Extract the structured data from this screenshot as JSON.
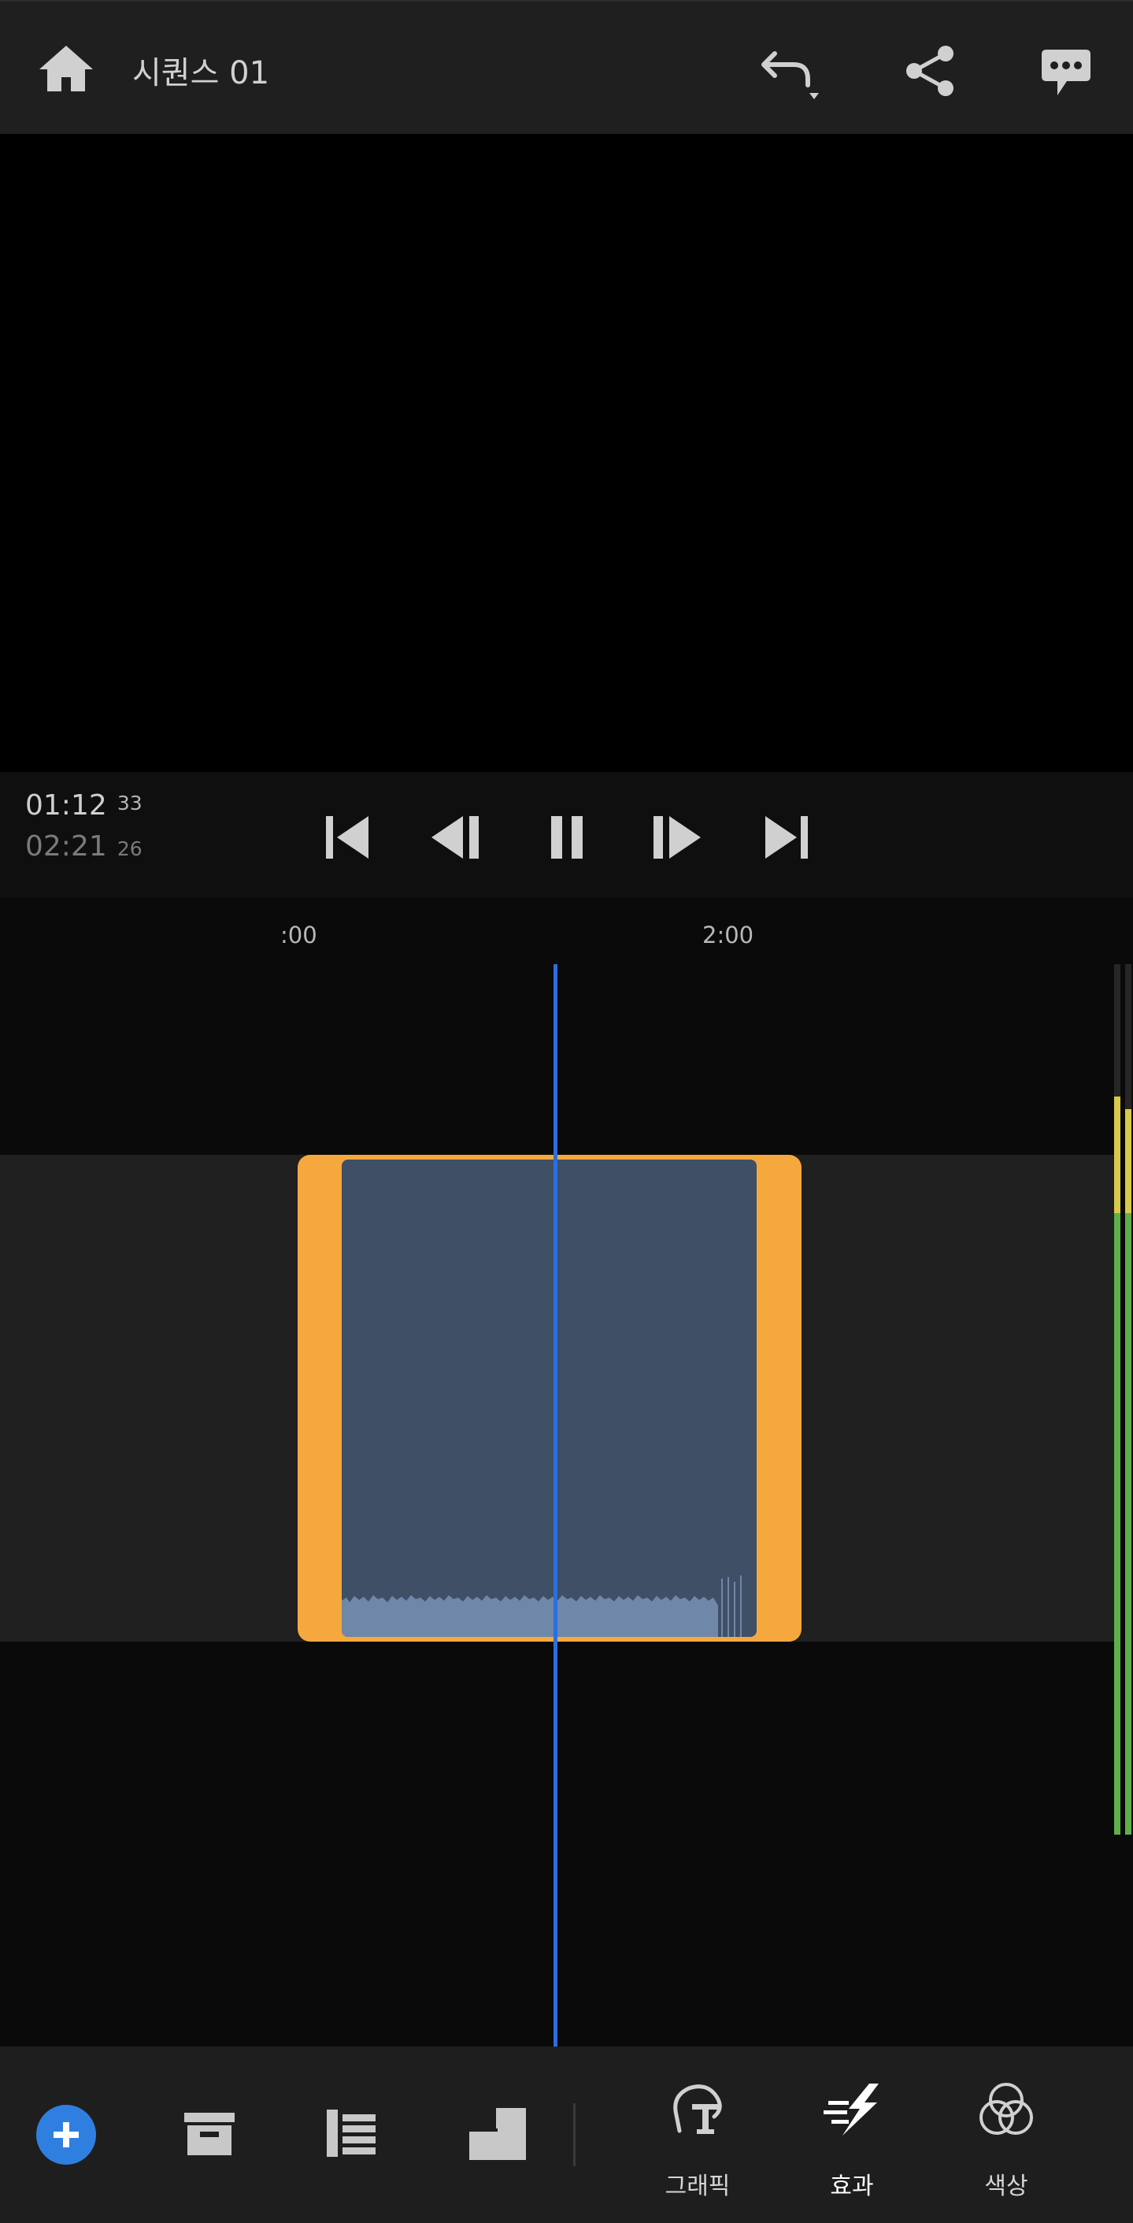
{
  "header": {
    "title": "시퀀스 01",
    "icons": [
      "home-icon",
      "undo-icon",
      "share-icon",
      "comment-icon"
    ]
  },
  "transport": {
    "current_time": "01:12",
    "current_frame": "33",
    "total_time": "02:21",
    "total_frame": "26",
    "controls": [
      "skip-to-start-icon",
      "step-back-icon",
      "pause-icon",
      "step-forward-icon",
      "skip-to-end-icon"
    ]
  },
  "timeline": {
    "ruler_labels": [
      ":00",
      "2:00"
    ]
  },
  "bottom_toolbar": {
    "left_tools": [
      "add-icon",
      "archive-icon",
      "list-icon",
      "layers-icon"
    ],
    "tabs": [
      {
        "label": "그래픽",
        "icon": "graphics-icon"
      },
      {
        "label": "효과",
        "icon": "effects-icon"
      },
      {
        "label": "색상",
        "icon": "color-icon"
      }
    ]
  },
  "colors": {
    "clip_border": "#f5a83d",
    "clip_fill": "#3e4f66",
    "playhead": "#2a6fe0",
    "add_button": "#2f7fe0",
    "meter_green": "#5db04a",
    "meter_yellow": "#d9c94a"
  }
}
